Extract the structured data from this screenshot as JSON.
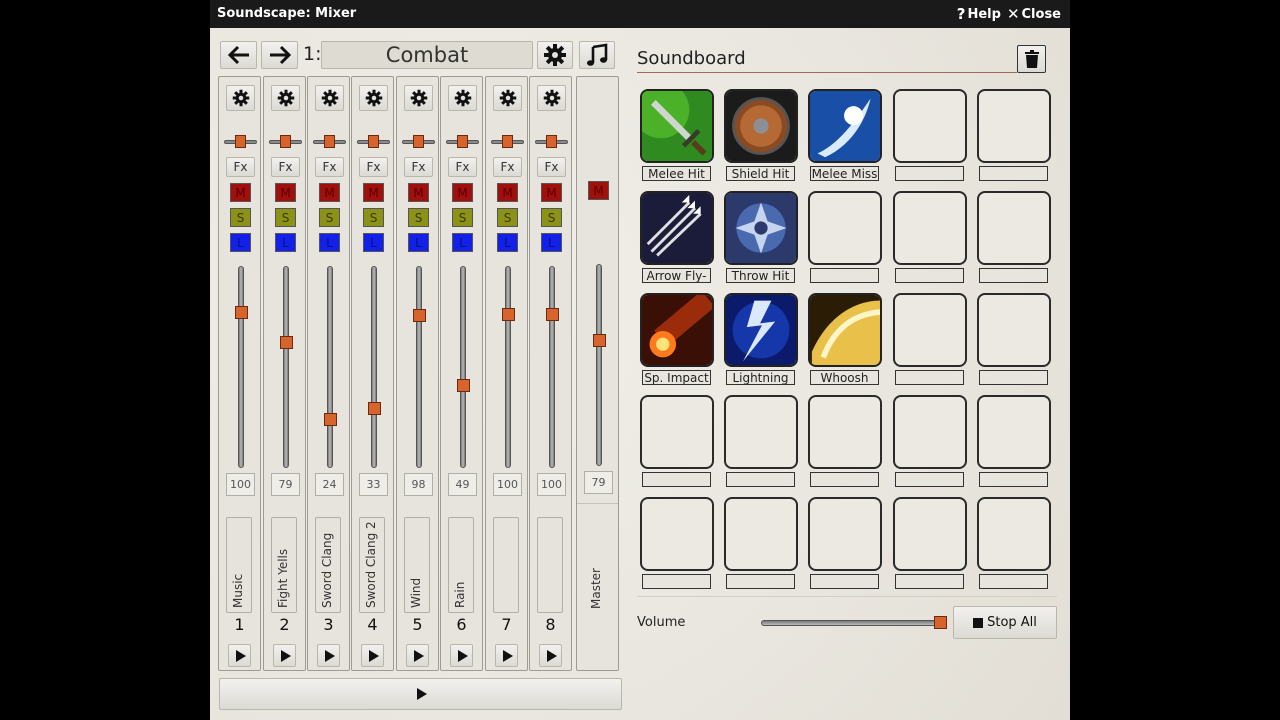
{
  "window": {
    "title": "Soundscape: Mixer",
    "help_label": "Help",
    "close_label": "Close"
  },
  "toolbar": {
    "scene_number": "1:",
    "scene_name": "Combat"
  },
  "channels": [
    {
      "number": "1",
      "name": "Music",
      "volume": "100",
      "fader_level": 0.79
    },
    {
      "number": "2",
      "name": "Fight Yells",
      "volume": "79",
      "fader_level": 0.63
    },
    {
      "number": "3",
      "name": "Sword Clang",
      "volume": "24",
      "fader_level": 0.22
    },
    {
      "number": "4",
      "name": "Sword Clang 2",
      "volume": "33",
      "fader_level": 0.28
    },
    {
      "number": "5",
      "name": "Wind",
      "volume": "98",
      "fader_level": 0.77
    },
    {
      "number": "6",
      "name": "Rain",
      "volume": "49",
      "fader_level": 0.4
    },
    {
      "number": "7",
      "name": "",
      "volume": "100",
      "fader_level": 0.78
    },
    {
      "number": "8",
      "name": "",
      "volume": "100",
      "fader_level": 0.78
    }
  ],
  "channel_buttons": {
    "fx": "Fx",
    "mute": "M",
    "solo": "S",
    "link": "L"
  },
  "master": {
    "name": "Master",
    "volume": "79",
    "mute": "M",
    "fader_level": 0.63
  },
  "soundboard": {
    "title": "Soundboard",
    "sounds": [
      {
        "label": "Melee Hit",
        "icon": "sword-icon"
      },
      {
        "label": "Shield Hit",
        "icon": "shield-icon"
      },
      {
        "label": "Melee Miss",
        "icon": "swoosh-icon"
      },
      {
        "label": "Arrow Fly-",
        "icon": "arrows-icon"
      },
      {
        "label": "Throw Hit",
        "icon": "shuriken-icon"
      },
      {
        "label": "Sp. Impact",
        "icon": "fireball-icon"
      },
      {
        "label": "Lightning",
        "icon": "lightning-icon"
      },
      {
        "label": "Whoosh",
        "icon": "whoosh-icon"
      }
    ],
    "volume_label": "Volume",
    "volume_level": 1.0,
    "stop_all_label": "Stop All"
  },
  "colors": {
    "mute": "#a0100d",
    "solo": "#8c9117",
    "link": "#1220e8",
    "knob": "#d8642d",
    "titlebar": "#1a1a1a"
  }
}
